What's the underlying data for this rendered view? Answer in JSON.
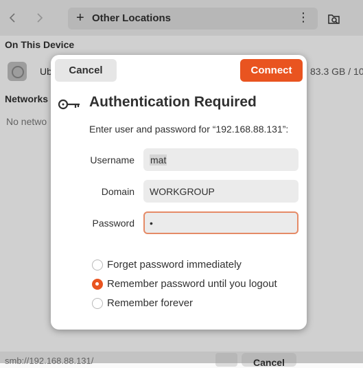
{
  "files": {
    "path_label": "Other Locations",
    "section_device": "On This Device",
    "disk_name": "Ub",
    "disk_size": "83.3 GB / 10",
    "section_networks": "Networks",
    "no_networks": "No netwo",
    "address": "smb://192.168.88.131/",
    "bottom_button": "Cancel"
  },
  "dialog": {
    "cancel_label": "Cancel",
    "connect_label": "Connect",
    "title": "Authentication Required",
    "message": "Enter user and password for “192.168.88.131”:",
    "username_label": "Username",
    "username_value": "mat",
    "domain_label": "Domain",
    "domain_value": "WORKGROUP",
    "password_label": "Password",
    "password_value": "•",
    "options": [
      {
        "label": "Forget password immediately",
        "checked": false
      },
      {
        "label": "Remember password until you logout",
        "checked": true
      },
      {
        "label": "Remember forever",
        "checked": false
      }
    ]
  },
  "colors": {
    "accent": "#e95420",
    "focus_border": "#e58a66"
  }
}
